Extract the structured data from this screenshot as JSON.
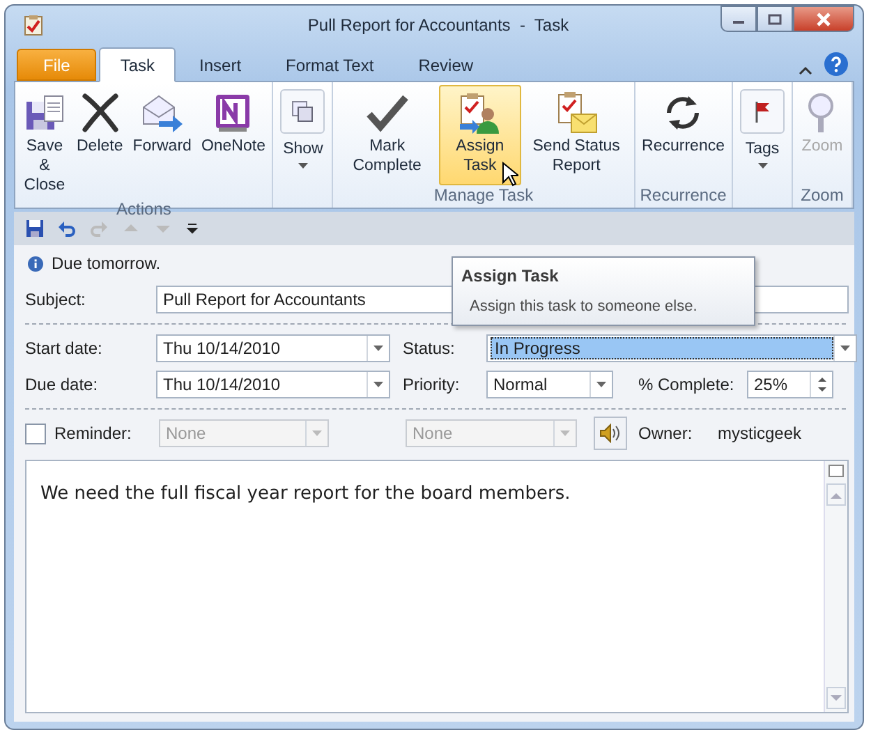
{
  "window": {
    "title": "Pull Report for Accountants  -  Task"
  },
  "tabs": [
    {
      "label": "File",
      "kind": "file",
      "selected": false
    },
    {
      "label": "Task",
      "kind": "tab",
      "selected": true
    },
    {
      "label": "Insert",
      "kind": "tab",
      "selected": false
    },
    {
      "label": "Format Text",
      "kind": "tab",
      "selected": false
    },
    {
      "label": "Review",
      "kind": "tab",
      "selected": false
    }
  ],
  "ribbon": {
    "groups": [
      {
        "label": "Actions",
        "buttons": [
          {
            "label": "Save & Close",
            "kind": "large",
            "hovered": false,
            "disabled": false
          },
          {
            "label": "Delete",
            "kind": "large",
            "hovered": false,
            "disabled": false
          },
          {
            "label": "Forward",
            "kind": "large",
            "hovered": false,
            "disabled": false
          },
          {
            "label": "OneNote",
            "kind": "large",
            "hovered": false,
            "disabled": false
          }
        ]
      },
      {
        "buttons": [
          {
            "label": "Show",
            "kind": "dropdown",
            "hovered": false,
            "disabled": false
          }
        ]
      },
      {
        "label": "Manage Task",
        "buttons": [
          {
            "label": "Mark Complete",
            "kind": "large",
            "hovered": false,
            "disabled": false
          },
          {
            "label": "Assign Task",
            "kind": "large",
            "hovered": true,
            "disabled": false
          },
          {
            "label": "Send Status Report",
            "kind": "large",
            "hovered": false,
            "disabled": false
          }
        ]
      },
      {
        "label": "Recurrence",
        "buttons": [
          {
            "label": "Recurrence",
            "kind": "large",
            "hovered": false,
            "disabled": false
          }
        ]
      },
      {
        "buttons": [
          {
            "label": "Tags",
            "kind": "dropdown",
            "hovered": false,
            "disabled": false
          }
        ]
      },
      {
        "label": "Zoom",
        "buttons": [
          {
            "label": "Zoom",
            "kind": "large",
            "hovered": false,
            "disabled": true
          }
        ]
      }
    ]
  },
  "info": "Due tomorrow.",
  "tooltip": {
    "title": "Assign Task",
    "text": "Assign this task to someone else."
  },
  "form": {
    "subject": {
      "label": "Subject:",
      "value": "Pull Report for Accountants"
    },
    "start_date": {
      "label": "Start date:",
      "value": "Thu 10/14/2010"
    },
    "due_date": {
      "label": "Due date:",
      "value": "Thu 10/14/2010"
    },
    "status": {
      "label": "Status:",
      "value": "In Progress",
      "selected": true
    },
    "priority": {
      "label": "Priority:",
      "value": "Normal"
    },
    "complete": {
      "label": "% Complete:",
      "value": "25%"
    },
    "reminder": {
      "label": "Reminder:",
      "checked": false,
      "date": "None",
      "time": "None"
    },
    "owner": {
      "label": "Owner:",
      "value": "mysticgeek"
    }
  },
  "body": "We need the full fiscal year report for the board members."
}
